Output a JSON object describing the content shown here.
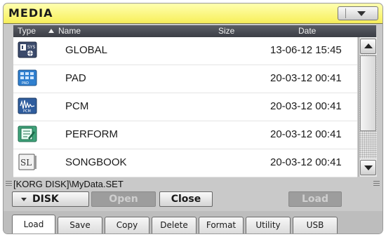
{
  "header": {
    "title": "MEDIA"
  },
  "columns": {
    "type": "Type",
    "name": "Name",
    "size": "Size",
    "date": "Date"
  },
  "files": [
    {
      "name": "GLOBAL",
      "date": "13-06-12 15:45",
      "icon": "global-set-icon"
    },
    {
      "name": "PAD",
      "date": "20-03-12 00:41",
      "icon": "pad-icon"
    },
    {
      "name": "PCM",
      "date": "20-03-12 00:41",
      "icon": "pcm-icon"
    },
    {
      "name": "PERFORM",
      "date": "20-03-12 00:41",
      "icon": "perform-icon"
    },
    {
      "name": "SONGBOOK",
      "date": "20-03-12 00:41",
      "icon": "songbook-icon"
    }
  ],
  "path": "[KORG DISK]\\MyData.SET",
  "buttons": {
    "device": "DISK",
    "open": "Open",
    "close": "Close",
    "load": "Load"
  },
  "tabs": [
    "Load",
    "Save",
    "Copy",
    "Delete",
    "Format",
    "Utility",
    "USB"
  ],
  "active_tab": "Load",
  "colors": {
    "title_bar": "#f7ef5a",
    "header_bg": "#44474e",
    "screen_bg": "#c9c9c9"
  }
}
